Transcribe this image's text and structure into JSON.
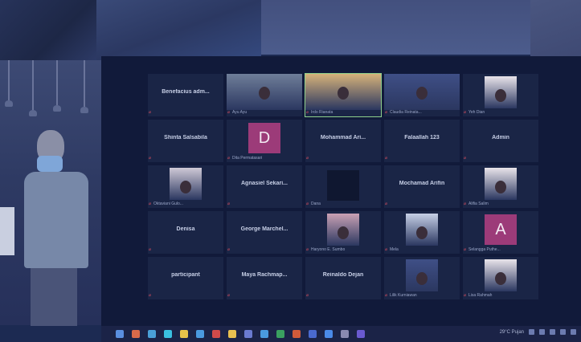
{
  "participants": [
    {
      "name": "Benefacius adm...",
      "caption": "",
      "kind": "name"
    },
    {
      "name": "",
      "caption": "Ayu Ayu",
      "kind": "video"
    },
    {
      "name": "",
      "caption": "Irdo Rianata",
      "kind": "video-active"
    },
    {
      "name": "",
      "caption": "Claudia Reinata...",
      "kind": "video"
    },
    {
      "name": "",
      "caption": "Yeh Dian",
      "kind": "video"
    },
    {
      "name": "Shinta Salsabila",
      "caption": "",
      "kind": "name"
    },
    {
      "name": "",
      "caption": "Dita Permatasari",
      "kind": "avatar",
      "letter": "D",
      "color": "#9c3b79"
    },
    {
      "name": "Mohammad Ari...",
      "caption": "",
      "kind": "name"
    },
    {
      "name": "Falaallah 123",
      "caption": "",
      "kind": "name"
    },
    {
      "name": "Admin",
      "caption": "",
      "kind": "name"
    },
    {
      "name": "",
      "caption": "Oktaviani Gulo...",
      "kind": "video"
    },
    {
      "name": "Agnasiel Sekari...",
      "caption": "",
      "kind": "name"
    },
    {
      "name": "",
      "caption": "Dana",
      "kind": "dark"
    },
    {
      "name": "Mochamad Arifin",
      "caption": "",
      "kind": "name"
    },
    {
      "name": "",
      "caption": "Alifia Salim",
      "kind": "video"
    },
    {
      "name": "Denisa",
      "caption": "",
      "kind": "name"
    },
    {
      "name": "George Marchel...",
      "caption": "",
      "kind": "name"
    },
    {
      "name": "",
      "caption": "Haryono E. Sumbo",
      "kind": "video"
    },
    {
      "name": "",
      "caption": "Mela",
      "kind": "video"
    },
    {
      "name": "",
      "caption": "Selangga Puthe...",
      "kind": "avatar",
      "letter": "A",
      "color": "#9c3b79"
    },
    {
      "name": "participant",
      "caption": "",
      "kind": "name"
    },
    {
      "name": "Maya Rachmap...",
      "caption": "",
      "kind": "name"
    },
    {
      "name": "Reinaldo Dejan",
      "caption": "",
      "kind": "name"
    },
    {
      "name": "",
      "caption": "Lilik Kurniawan",
      "kind": "video"
    },
    {
      "name": "",
      "caption": "Lisa Rahmah",
      "kind": "video"
    }
  ],
  "taskbar": {
    "weather": "29°C Pujan",
    "icons": [
      "start-icon",
      "search-icon",
      "task-view-icon",
      "widgets-icon",
      "chat-icon",
      "edge-icon",
      "chrome-icon",
      "files-icon",
      "store-icon",
      "mail-icon",
      "excel-icon",
      "powerpoint-icon",
      "word-icon",
      "zoom-icon",
      "settings-icon",
      "teams-icon"
    ]
  }
}
